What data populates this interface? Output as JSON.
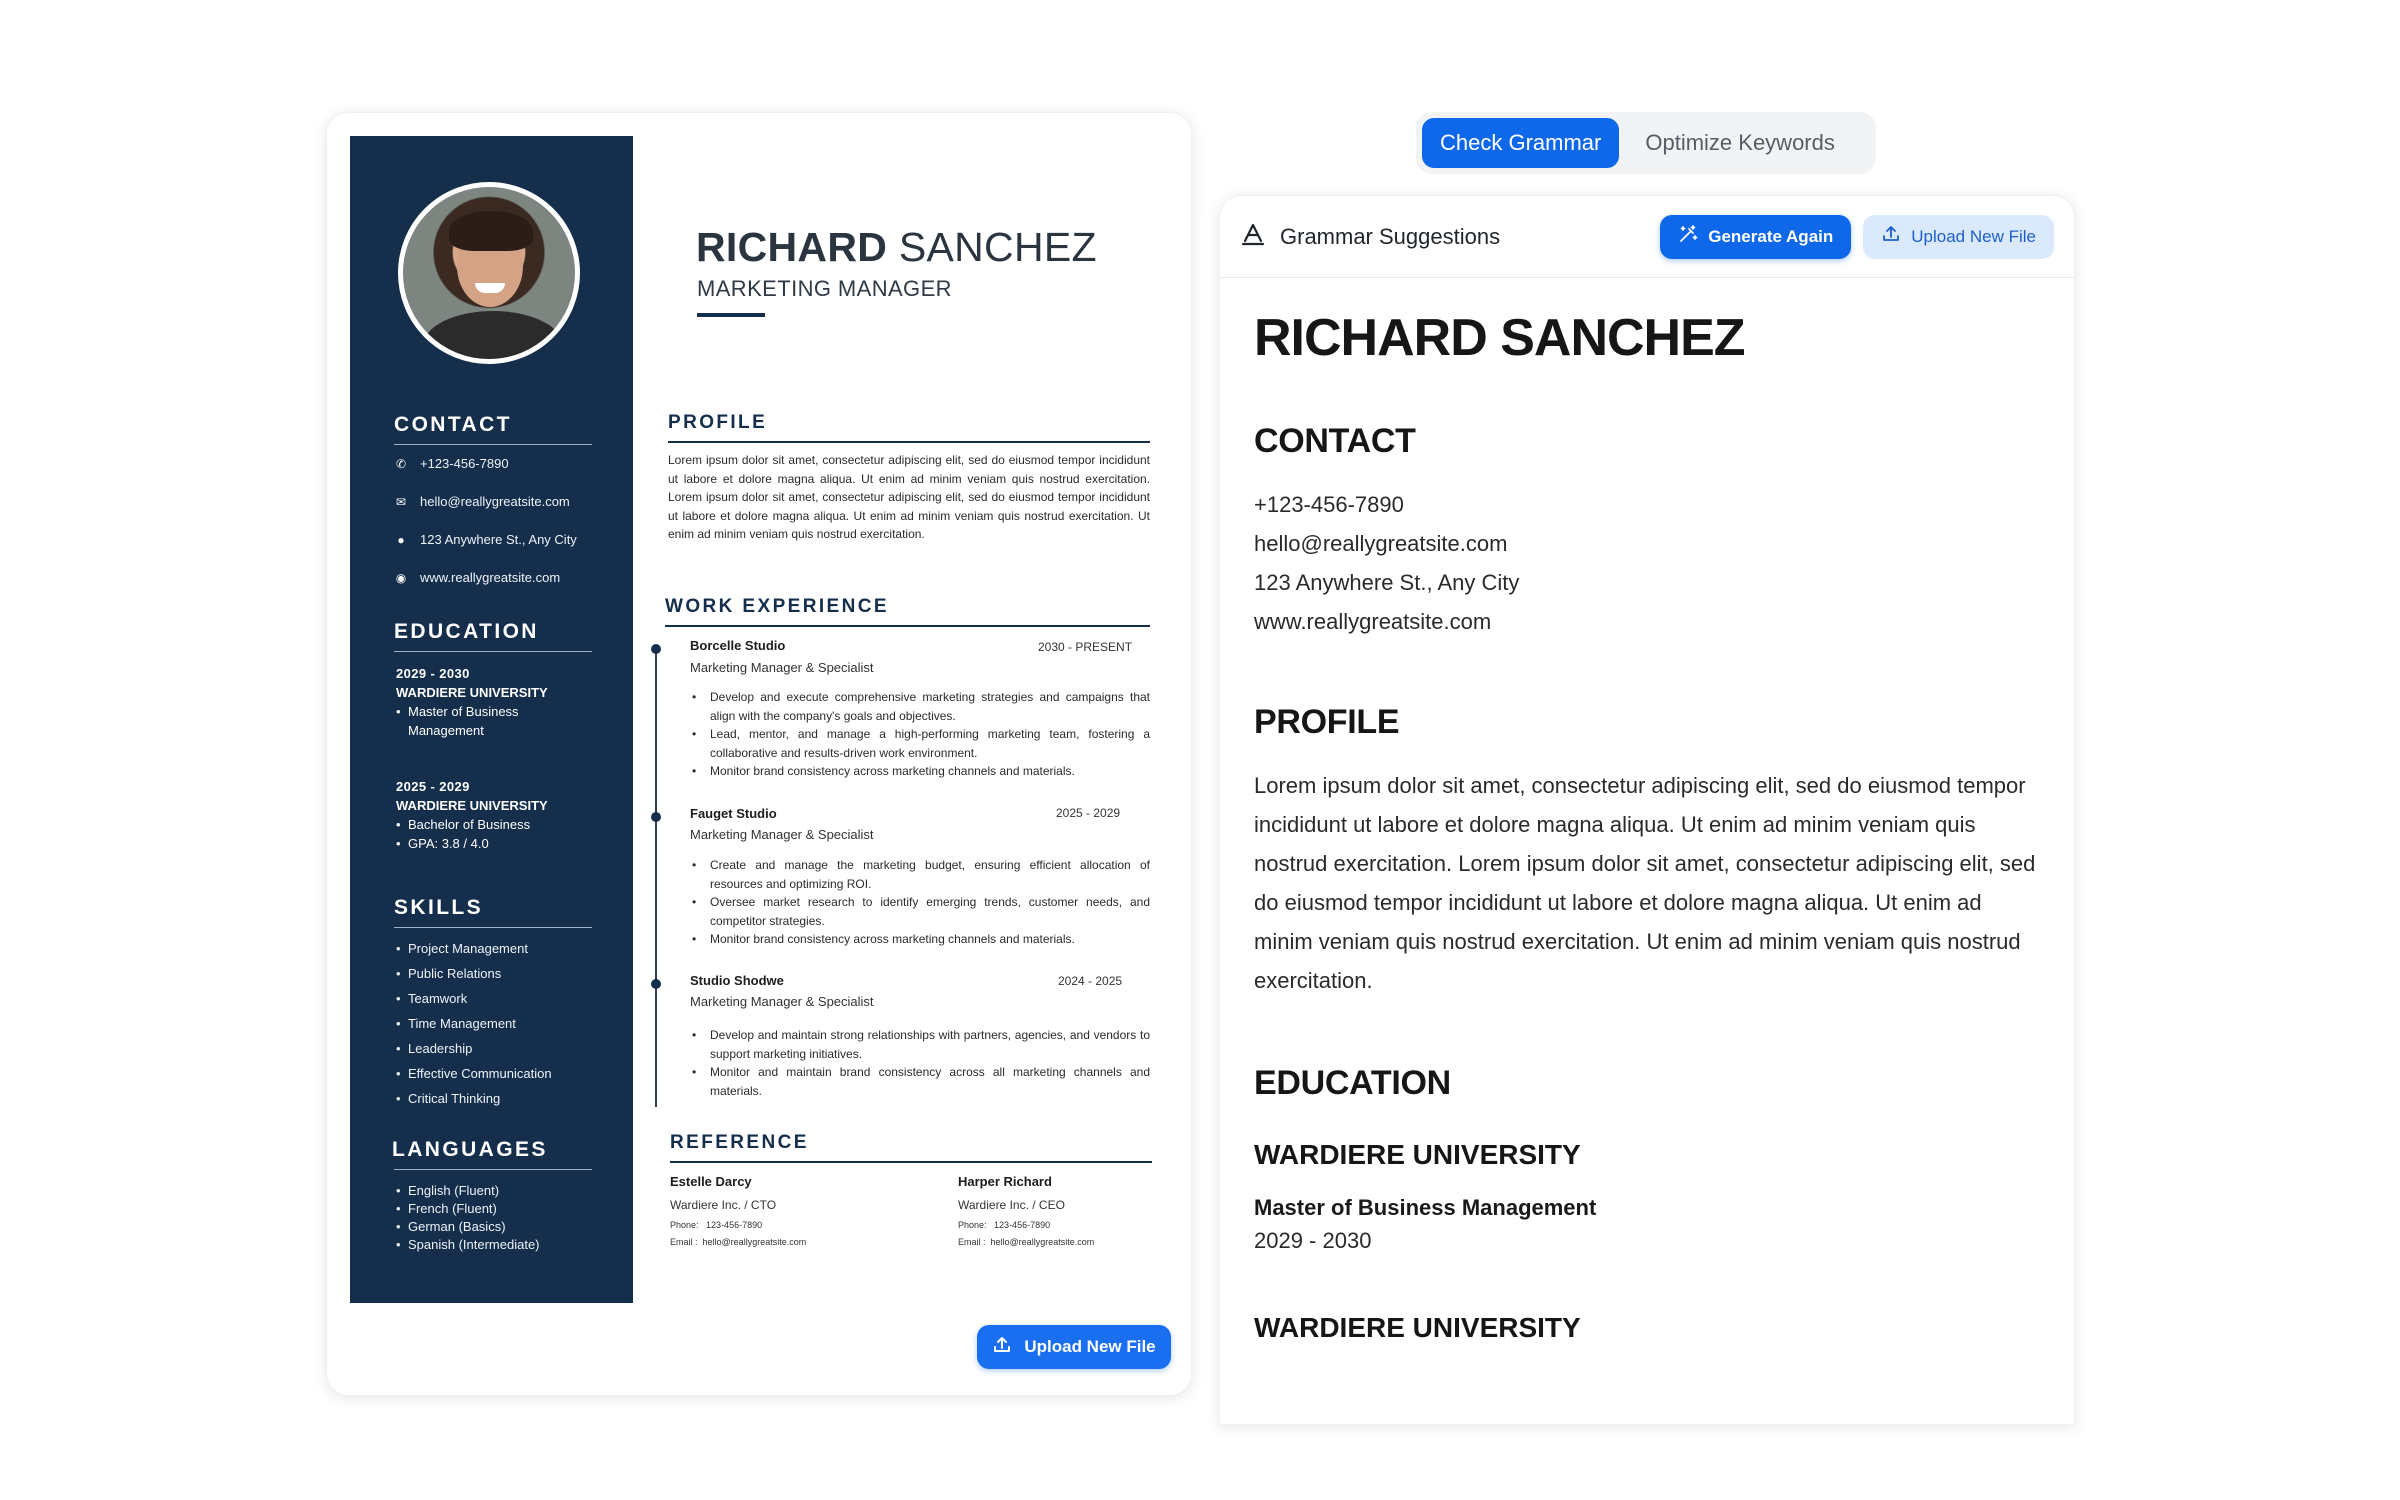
{
  "resume": {
    "first_name": "RICHARD",
    "last_name": "SANCHEZ",
    "title": "MARKETING MANAGER",
    "contact_heading": "CONTACT",
    "contact": {
      "phone": "+123-456-7890",
      "email": "hello@reallygreatsite.com",
      "address": "123 Anywhere St., Any City",
      "website": "www.reallygreatsite.com"
    },
    "education_heading": "EDUCATION",
    "education": [
      {
        "years": "2029 - 2030",
        "university": "WARDIERE UNIVERSITY",
        "items": [
          "Master of Business",
          "Management"
        ]
      },
      {
        "years": "2025 - 2029",
        "university": "WARDIERE UNIVERSITY",
        "items": [
          "Bachelor of Business",
          "GPA: 3.8 / 4.0"
        ]
      }
    ],
    "skills_heading": "SKILLS",
    "skills": [
      "Project Management",
      "Public Relations",
      "Teamwork",
      "Time Management",
      "Leadership",
      "Effective Communication",
      "Critical Thinking"
    ],
    "languages_heading": "LANGUAGES",
    "languages": [
      "English (Fluent)",
      "French (Fluent)",
      "German (Basics)",
      "Spanish (Intermediate)"
    ],
    "profile_heading": "PROFILE",
    "profile_text": "Lorem ipsum dolor sit amet, consectetur adipiscing elit, sed do eiusmod tempor incididunt ut labore et dolore magna aliqua. Ut enim ad minim veniam quis nostrud exercitation. Lorem ipsum dolor sit amet, consectetur adipiscing elit, sed do eiusmod tempor incididunt ut labore et dolore magna aliqua. Ut enim ad minim veniam quis nostrud exercitation. Ut enim ad minim veniam quis nostrud exercitation.",
    "work_heading": "WORK EXPERIENCE",
    "jobs": [
      {
        "company": "Borcelle Studio",
        "dates": "2030 - PRESENT",
        "role": "Marketing Manager & Specialist",
        "bullets": [
          "Develop and execute comprehensive marketing strategies and campaigns that align with the company's goals and objectives.",
          "Lead, mentor, and manage a high-performing marketing team, fostering a collaborative and results-driven work environment.",
          "Monitor brand consistency across marketing channels and materials."
        ]
      },
      {
        "company": "Fauget Studio",
        "dates": "2025 - 2029",
        "role": "Marketing Manager & Specialist",
        "bullets": [
          "Create and manage the marketing budget, ensuring efficient allocation of resources and optimizing ROI.",
          "Oversee market research to identify emerging trends, customer needs, and competitor strategies.",
          "Monitor brand consistency across marketing channels and materials."
        ]
      },
      {
        "company": "Studio Shodwe",
        "dates": "2024 - 2025",
        "role": "Marketing Manager & Specialist",
        "bullets": [
          "Develop and maintain strong relationships with partners, agencies, and vendors to support marketing initiatives.",
          "Monitor and maintain brand consistency across all marketing channels and materials."
        ]
      }
    ],
    "reference_heading": "REFERENCE",
    "references": [
      {
        "name": "Estelle Darcy",
        "company": "Wardiere Inc. / CTO",
        "phone_label": "Phone:",
        "phone": "123-456-7890",
        "email_label": "Email :",
        "email": "hello@reallygreatsite.com"
      },
      {
        "name": "Harper Richard",
        "company": "Wardiere Inc. / CEO",
        "phone_label": "Phone:",
        "phone": "123-456-7890",
        "email_label": "Email :",
        "email": "hello@reallygreatsite.com"
      }
    ],
    "upload_button": "Upload New File"
  },
  "tabs": [
    {
      "label": "Check Grammar",
      "active": true
    },
    {
      "label": "Optimize Keywords",
      "active": false
    }
  ],
  "panel": {
    "title": "Grammar Suggestions",
    "title_icon": "text-grammar-icon",
    "generate_button": "Generate Again",
    "generate_icon": "magic-wand-icon",
    "upload_button": "Upload New File",
    "upload_icon": "upload-icon",
    "doc": {
      "name": "RICHARD SANCHEZ",
      "contact_heading": "CONTACT",
      "contact_lines": [
        "+123-456-7890",
        "hello@reallygreatsite.com",
        "123 Anywhere St., Any City",
        "www.reallygreatsite.com"
      ],
      "profile_heading": "PROFILE",
      "profile_text": "Lorem ipsum dolor sit amet, consectetur adipiscing elit, sed do eiusmod tempor incididunt ut labore et dolore magna aliqua. Ut enim ad minim veniam quis nostrud exercitation. Lorem ipsum dolor sit amet, consectetur adipiscing elit, sed do eiusmod tempor incididunt ut labore et dolore magna aliqua. Ut enim ad minim veniam quis nostrud exercitation. Ut enim ad minim veniam quis nostrud exercitation.",
      "education_heading": "EDUCATION",
      "education": [
        {
          "university": "WARDIERE UNIVERSITY",
          "degree": "Master of Business Management",
          "years": "2029 - 2030"
        },
        {
          "university": "WARDIERE UNIVERSITY"
        }
      ]
    }
  },
  "colors": {
    "sidebar": "#142e4b",
    "accent": "#0f67ea",
    "secondary_button": "#dbe9fd"
  }
}
